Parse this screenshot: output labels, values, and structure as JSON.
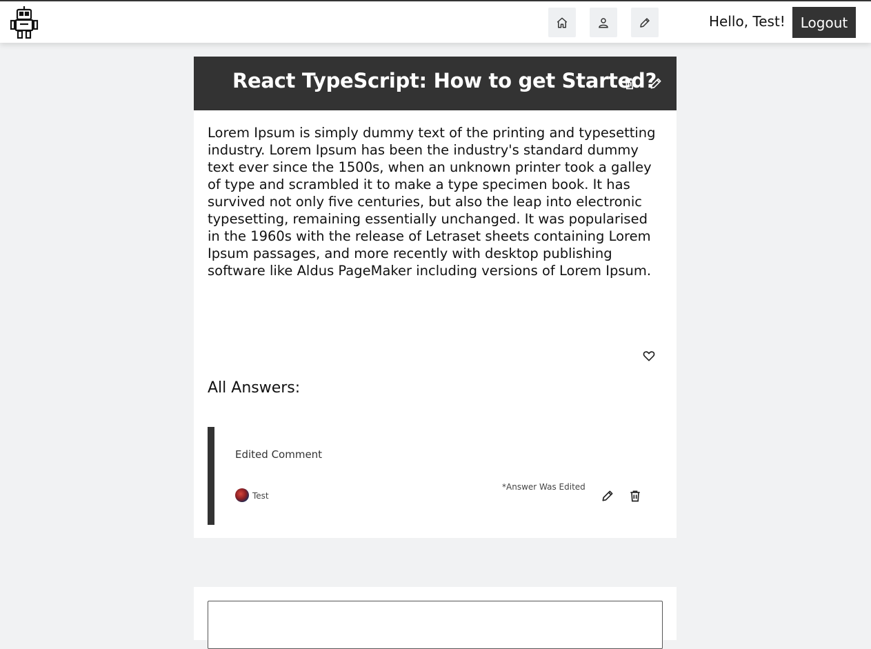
{
  "header": {
    "logo_icon": "robot-icon",
    "nav": [
      {
        "name": "home",
        "icon": "home-icon"
      },
      {
        "name": "profile",
        "icon": "user-icon"
      },
      {
        "name": "write",
        "icon": "pencil-icon"
      }
    ],
    "greeting": "Hello, Test!",
    "logout_label": "Logout"
  },
  "question": {
    "title": "React TypeScript: How to get Started?",
    "body": "Lorem Ipsum is simply dummy text of the printing and typesetting industry. Lorem Ipsum has been the industry's standard dummy text ever since the 1500s, when an unknown printer took a galley of type and scrambled it to make a type specimen book. It has survived not only five centuries, but also the leap into electronic typesetting, remaining essentially unchanged. It was popularised in the 1960s with the release of Letraset sheets containing Lorem Ipsum passages, and more recently with desktop publishing software like Aldus PageMaker including versions of Lorem Ipsum.",
    "like_icon": "heart-icon"
  },
  "answers": {
    "heading": "All Answers:",
    "items": [
      {
        "text": "Edited Comment",
        "author": "Test",
        "edited_note": "*Answer Was Edited"
      }
    ]
  },
  "answer_form": {
    "placeholder": ""
  },
  "colors": {
    "accent_dark": "#333333",
    "page_bg": "#f1f2f3"
  }
}
